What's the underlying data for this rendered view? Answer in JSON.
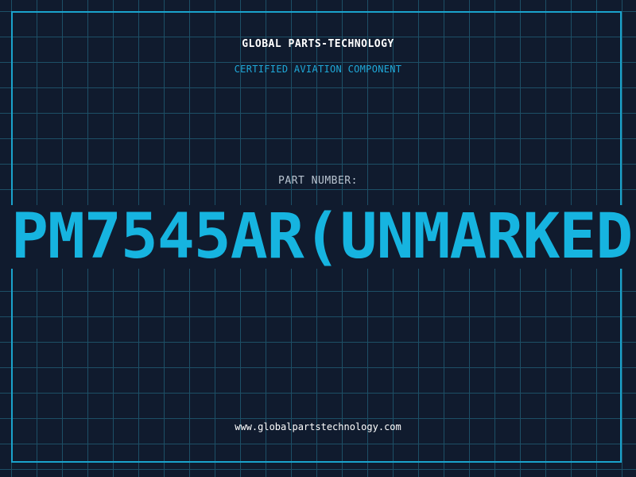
{
  "header": {
    "brand": "GLOBAL PARTS-TECHNOLOGY",
    "subtitle": "CERTIFIED AVIATION COMPONENT"
  },
  "part": {
    "label": "PART NUMBER:",
    "number": "PM7545AR(UNMARKED"
  },
  "footer": {
    "url": "www.globalpartstechnology.com"
  },
  "colors": {
    "background": "#101b2e",
    "grid": "#1d4f66",
    "accent": "#16b4e0",
    "border": "#1aa3cc"
  }
}
